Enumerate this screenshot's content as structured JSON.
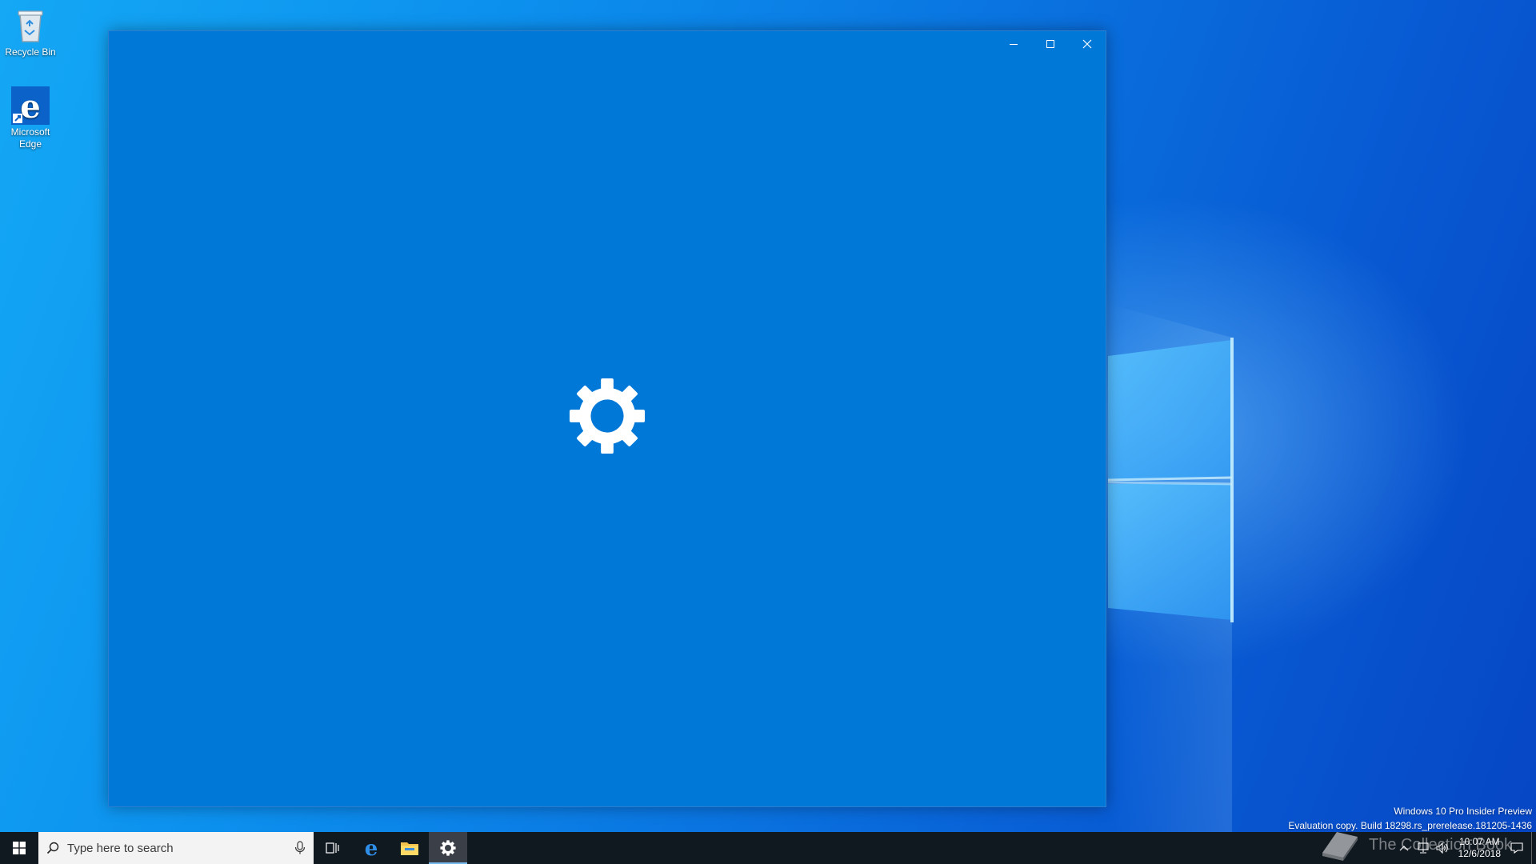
{
  "desktop": {
    "icons": [
      {
        "label": "Recycle Bin",
        "icon": "recycle-bin-icon"
      },
      {
        "label": "Microsoft\nEdge",
        "icon": "edge-icon"
      }
    ]
  },
  "window": {
    "app": "Settings",
    "splash_icon": "gear-icon",
    "background": "#0078d7",
    "controls": {
      "minimize": "minimize-icon",
      "maximize": "maximize-icon",
      "close": "close-icon"
    }
  },
  "watermark": {
    "line1": "Windows 10 Pro Insider Preview",
    "line2": "Evaluation copy. Build 18298.rs_prerelease.181205-1436"
  },
  "overlay_brand": "The Collection Book",
  "taskbar": {
    "search_placeholder": "Type here to search",
    "apps": [
      {
        "name": "Task View",
        "icon": "task-view-icon"
      },
      {
        "name": "Microsoft Edge",
        "icon": "edge-icon"
      },
      {
        "name": "File Explorer",
        "icon": "folder-icon"
      },
      {
        "name": "Settings",
        "icon": "gear-icon",
        "active": true
      }
    ],
    "tray": {
      "time": "10:07 AM",
      "date": "12/6/2018"
    },
    "accent": "#76b9ed"
  }
}
